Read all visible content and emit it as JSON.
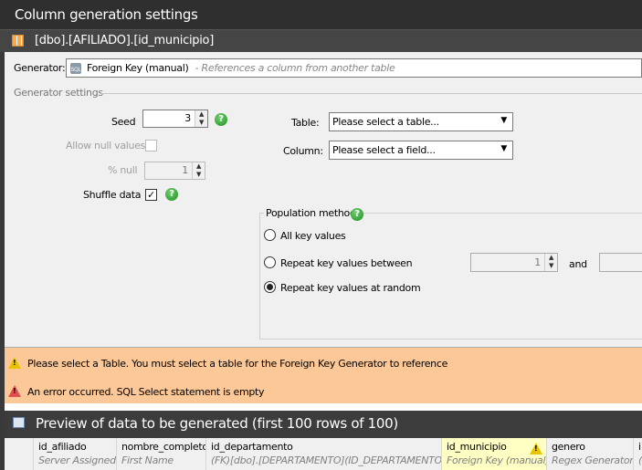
{
  "window": {
    "title": "Column generation settings",
    "column_path": "[dbo].[AFILIADO].[id_municipio]"
  },
  "generator": {
    "label": "Generator:",
    "name": "Foreign Key (manual)",
    "description": "- References a column from another table",
    "icon": "sql-database-icon"
  },
  "settings": {
    "group_label": "Generator settings",
    "seed": {
      "label": "Seed",
      "value": "3"
    },
    "allow_null": {
      "label": "Allow null values",
      "checked": false,
      "enabled": false
    },
    "percent_null": {
      "label": "% null",
      "value": "1",
      "enabled": false
    },
    "shuffle": {
      "label": "Shuffle data",
      "checked": true
    },
    "table": {
      "label": "Table:",
      "value": "Please select a table..."
    },
    "column": {
      "label": "Column:",
      "value": "Please select a field..."
    }
  },
  "population": {
    "label": "Population method",
    "options": [
      {
        "label": "All key values",
        "selected": false
      },
      {
        "label": "Repeat key values between",
        "selected": false
      },
      {
        "label": "Repeat key values at random",
        "selected": true
      }
    ],
    "between_min": "1",
    "and_label": "and"
  },
  "messages": [
    {
      "type": "warning",
      "text": "Please select a Table. You must select a table for the Foreign Key Generator to reference"
    },
    {
      "type": "error",
      "text": "An error occurred. SQL Select statement is empty"
    }
  ],
  "messages_bg": "#fdc897",
  "preview": {
    "title": "Preview of data to be generated (first 100 rows of 100)",
    "columns": [
      {
        "name": "id_afiliado",
        "generator": "Server Assigned"
      },
      {
        "name": "nombre_completo",
        "generator": "First Name"
      },
      {
        "name": "id_departamento",
        "generator": "(FK)[dbo].[DEPARTAMENTO](ID_DEPARTAMENTO)"
      },
      {
        "name": "id_municipio",
        "generator": "Foreign Key (manual)",
        "warning": true
      },
      {
        "name": "genero",
        "generator": "Regex Generator"
      },
      {
        "name": "i",
        "generator": "("
      }
    ]
  }
}
